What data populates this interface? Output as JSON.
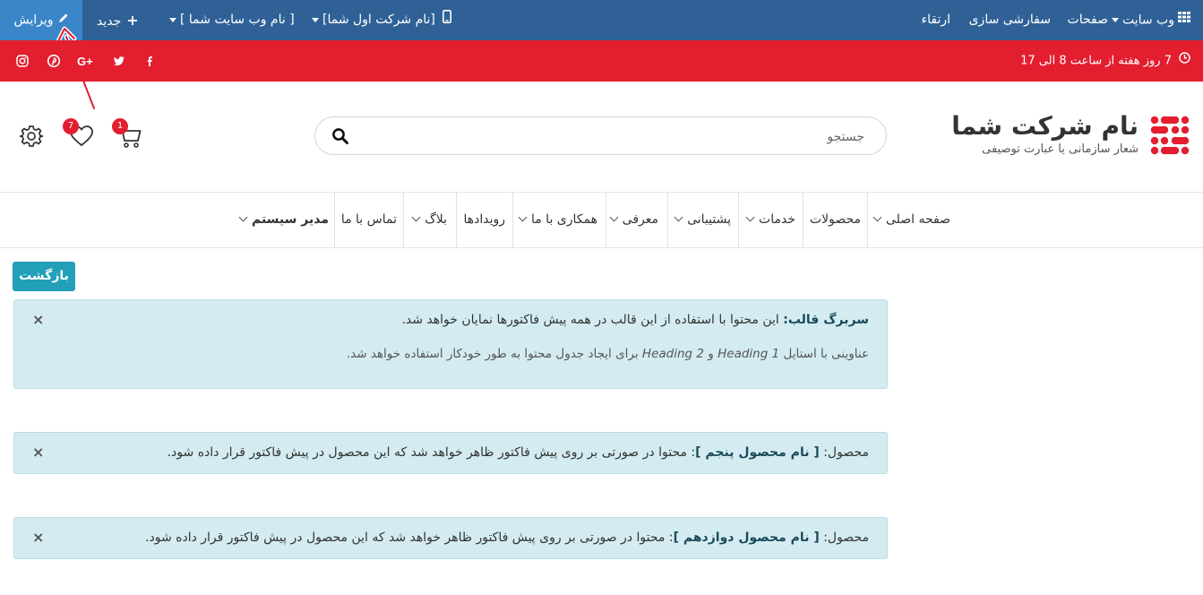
{
  "topbar": {
    "website": "وب سایت",
    "pages": "صفحات",
    "customize": "سفارشی سازی",
    "upgrade": "ارتقاء",
    "company": "[نام شرکت اول شما]",
    "site_name": "[ نام وب سایت شما ]",
    "new": "جدید",
    "edit": "ویرایش"
  },
  "redbar": {
    "hours": "7 روز هفته از ساعت 8 الی 17"
  },
  "brand": {
    "name": "نام شرکت شما",
    "slogan": "شعار سازمانی یا عبارت توصیفی",
    "color": "#e31e2f"
  },
  "search": {
    "placeholder": "جستجو"
  },
  "header_icons": {
    "cart_count": "1",
    "wishlist_count": "7"
  },
  "nav": {
    "home": "صفحه اصلی",
    "products": "محصولات",
    "services": "خدمات",
    "support": "پشتیبانی",
    "intro": "معرفی",
    "cooperate": "همکاری با ما",
    "events": "رویدادها",
    "blog": "بلاگ",
    "contact": "تماس با ما",
    "admin": "مدیر سیستم"
  },
  "back_button": "بازگشت",
  "alerts": {
    "header": {
      "label": "سربرگ قالب:",
      "text": "این محتوا با استفاده از این قالب در همه پیش فاکتورها نمایان خواهد شد.",
      "note_prefix": "عناوینی با استایل",
      "h1": "Heading 1",
      "and": "و",
      "h2": "Heading 2",
      "note_suffix": "برای ایجاد جدول محتوا به طور خودکار استفاده خواهد شد."
    },
    "product5": {
      "prefix": "محصول:",
      "name": "[ نام محصول پنجم ]",
      "text": ": محتوا در صورتی بر روی پیش فاکتور ظاهر خواهد شد که این محصول در پیش فاکتور قرار داده شود."
    },
    "product12": {
      "prefix": "محصول:",
      "name": "[ نام محصول دوازدهم ]",
      "text": ": محتوا در صورتی بر روی پیش فاکتور ظاهر خواهد شد که این محصول در پیش فاکتور قرار داده شود."
    },
    "close": "×"
  }
}
